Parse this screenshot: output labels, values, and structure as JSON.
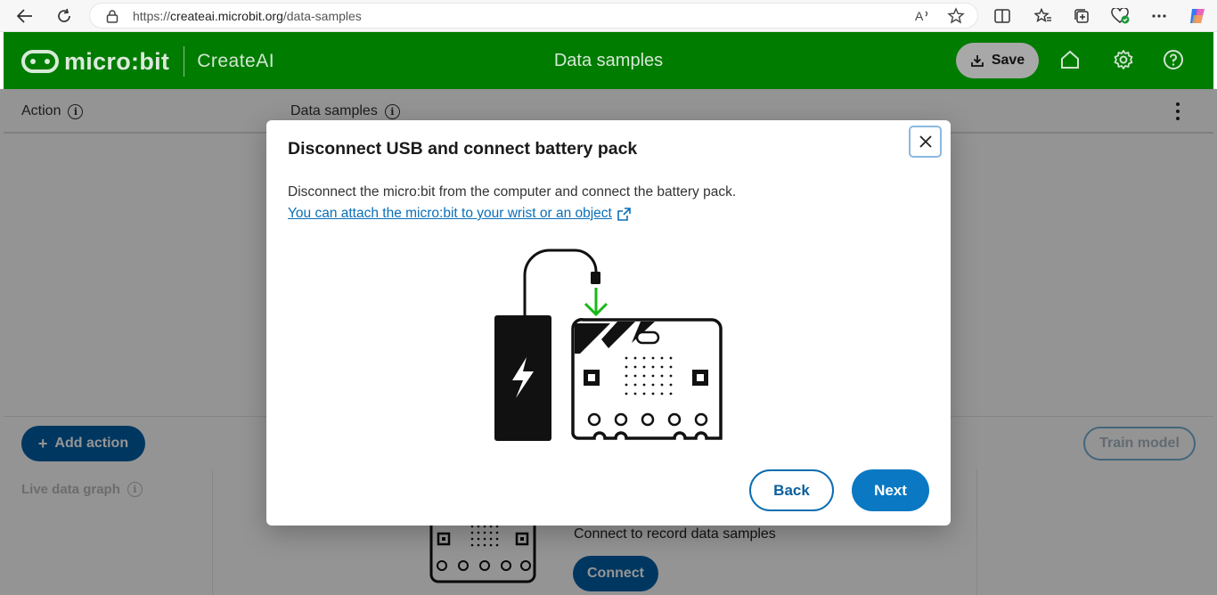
{
  "browser": {
    "url_prefix": "https://",
    "url_host": "createai.microbit.org",
    "url_path": "/data-samples"
  },
  "header": {
    "brand": "micro:bit",
    "product": "CreateAI",
    "title": "Data samples",
    "save_label": "Save"
  },
  "columns": {
    "action_label": "Action",
    "samples_label": "Data samples"
  },
  "actions": {
    "add_action_label": "Add action",
    "train_model_label": "Train model"
  },
  "graph": {
    "title": "Live data graph",
    "connect_prompt": "Connect to record data samples",
    "connect_label": "Connect"
  },
  "modal": {
    "title": "Disconnect USB and connect battery pack",
    "description": "Disconnect the micro:bit from the computer and connect the battery pack.",
    "link_text": "You can attach the micro:bit to your wrist or an object",
    "back_label": "Back",
    "next_label": "Next"
  },
  "colors": {
    "header_green": "#007c00",
    "primary_blue": "#0a78c2",
    "arrow_green": "#18b818"
  }
}
